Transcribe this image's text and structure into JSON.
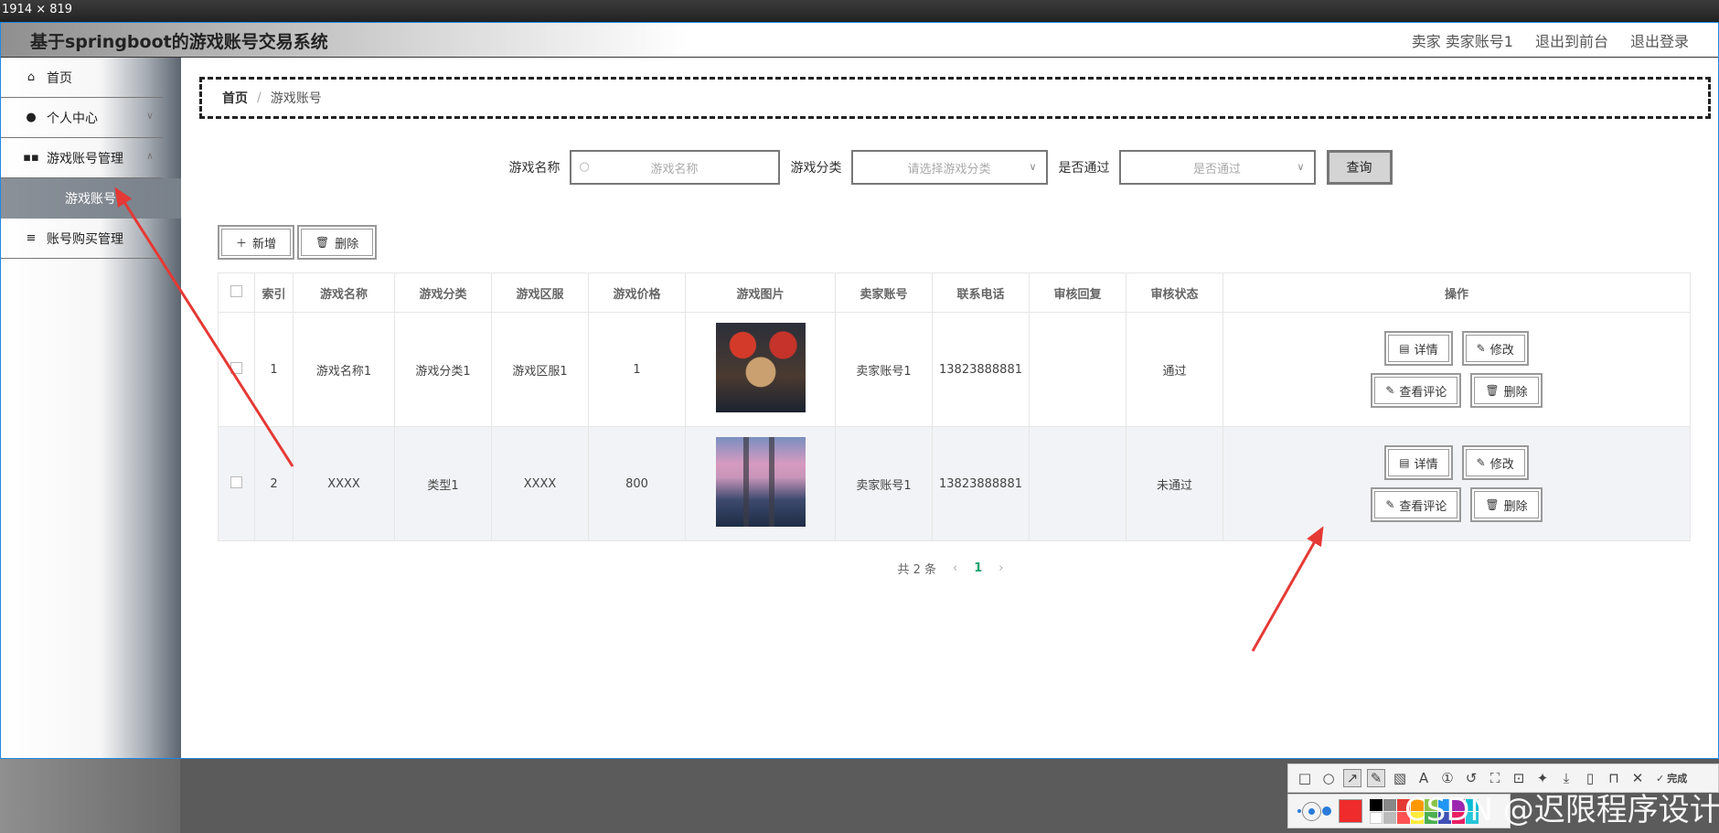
{
  "screen_label": "1914 × 819",
  "header": {
    "title": "基于springboot的游戏账号交易系统",
    "user": "卖家 卖家账号1",
    "to_front": "退出到前台",
    "logout": "退出登录"
  },
  "sidebar": {
    "items": [
      {
        "label": "首页",
        "icon": "home-icon"
      },
      {
        "label": "个人中心",
        "icon": "user-icon"
      },
      {
        "label": "游戏账号管理",
        "icon": "grid-icon"
      },
      {
        "label": "游戏账号",
        "icon": ""
      },
      {
        "label": "账号购买管理",
        "icon": "list-icon"
      }
    ]
  },
  "breadcrumb": {
    "home": "首页",
    "separator": "/",
    "current": "游戏账号"
  },
  "search": {
    "name_label": "游戏名称",
    "name_placeholder": "游戏名称",
    "category_label": "游戏分类",
    "category_placeholder": "请选择游戏分类",
    "passed_label": "是否通过",
    "passed_placeholder": "是否通过",
    "query_button": "查询"
  },
  "actions": {
    "add": "新增",
    "delete": "删除"
  },
  "table": {
    "columns": [
      "",
      "索引",
      "游戏名称",
      "游戏分类",
      "游戏区服",
      "游戏价格",
      "游戏图片",
      "卖家账号",
      "联系电话",
      "审核回复",
      "审核状态",
      "操作"
    ],
    "rows": [
      {
        "index": "1",
        "name": "游戏名称1",
        "category": "游戏分类1",
        "server": "游戏区服1",
        "price": "1",
        "seller": "卖家账号1",
        "phone": "13823888881",
        "reply": "",
        "status": "通过"
      },
      {
        "index": "2",
        "name": "XXXX",
        "category": "类型1",
        "server": "XXXX",
        "price": "800",
        "seller": "卖家账号1",
        "phone": "13823888881",
        "reply": "",
        "status": "未通过"
      }
    ],
    "op_labels": {
      "detail": "详情",
      "edit": "修改",
      "comments": "查看评论",
      "delete": "删除"
    }
  },
  "pagination": {
    "total": "共 2 条",
    "prev": "‹",
    "current": "1",
    "next": "›"
  },
  "snapshot_toolbar": {
    "done": "完成"
  },
  "watermark": "CSDN @迟限程序设计",
  "colors": {
    "accent": "#1aa36b",
    "annotation": "#e53935",
    "frame_border": "#1e88e5"
  }
}
